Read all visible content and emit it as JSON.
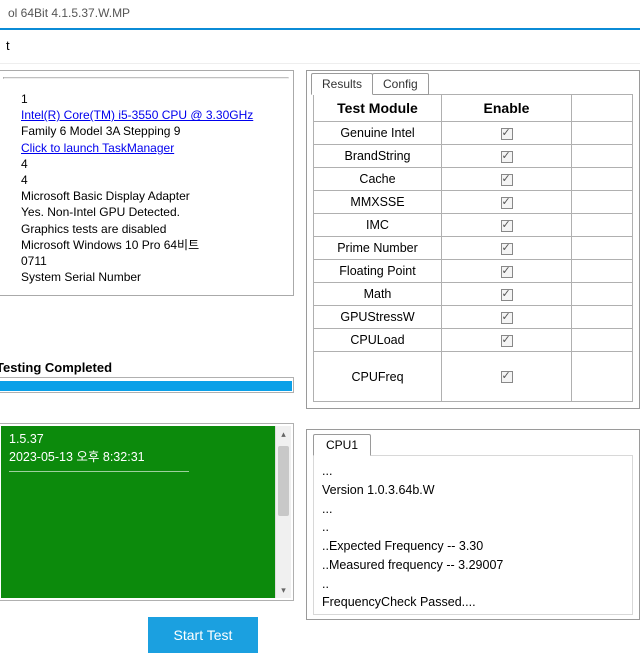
{
  "titlebar": "ol 64Bit 4.1.5.37.W.MP",
  "toolbar_item": "t",
  "info": {
    "l1": "1",
    "cpu_link": "Intel(R) Core(TM) i5-3550 CPU @ 3.30GHz",
    "family": "Family 6 Model 3A Stepping 9",
    "tm_link": "Click to launch TaskManager",
    "l4a": "4",
    "l4b": "4",
    "gpu": "Microsoft Basic Display Adapter",
    "gpu2": "Yes. Non-Intel GPU Detected.",
    "gpu3": "Graphics tests are disabled",
    "os": "Microsoft Windows 10 Pro 64비트",
    "build": "0711",
    "serial": "System Serial Number"
  },
  "status_label": "Testing Completed",
  "console": {
    "l1": "1.5.37",
    "l2": "2023-05-13 오후 8:32:31"
  },
  "start_button": "Start Test",
  "tabs": {
    "results": "Results",
    "config": "Config"
  },
  "grid": {
    "h_module": "Test Module",
    "h_enable": "Enable",
    "rows": [
      "Genuine Intel",
      "BrandString",
      "Cache",
      "MMXSSE",
      "IMC",
      "Prime Number",
      "Floating Point",
      "Math",
      "GPUStressW",
      "CPULoad",
      "CPUFreq"
    ]
  },
  "cpu": {
    "tab": "CPU1",
    "l1": "...",
    "l2": "Version 1.0.3.64b.W",
    "l3": "...",
    "l4": "..",
    "l5": "..Expected Frequency -- 3.30",
    "l6": "..Measured frequency -- 3.29007",
    "l7": "..",
    "l8": "",
    "l9": "FrequencyCheck Passed...."
  }
}
